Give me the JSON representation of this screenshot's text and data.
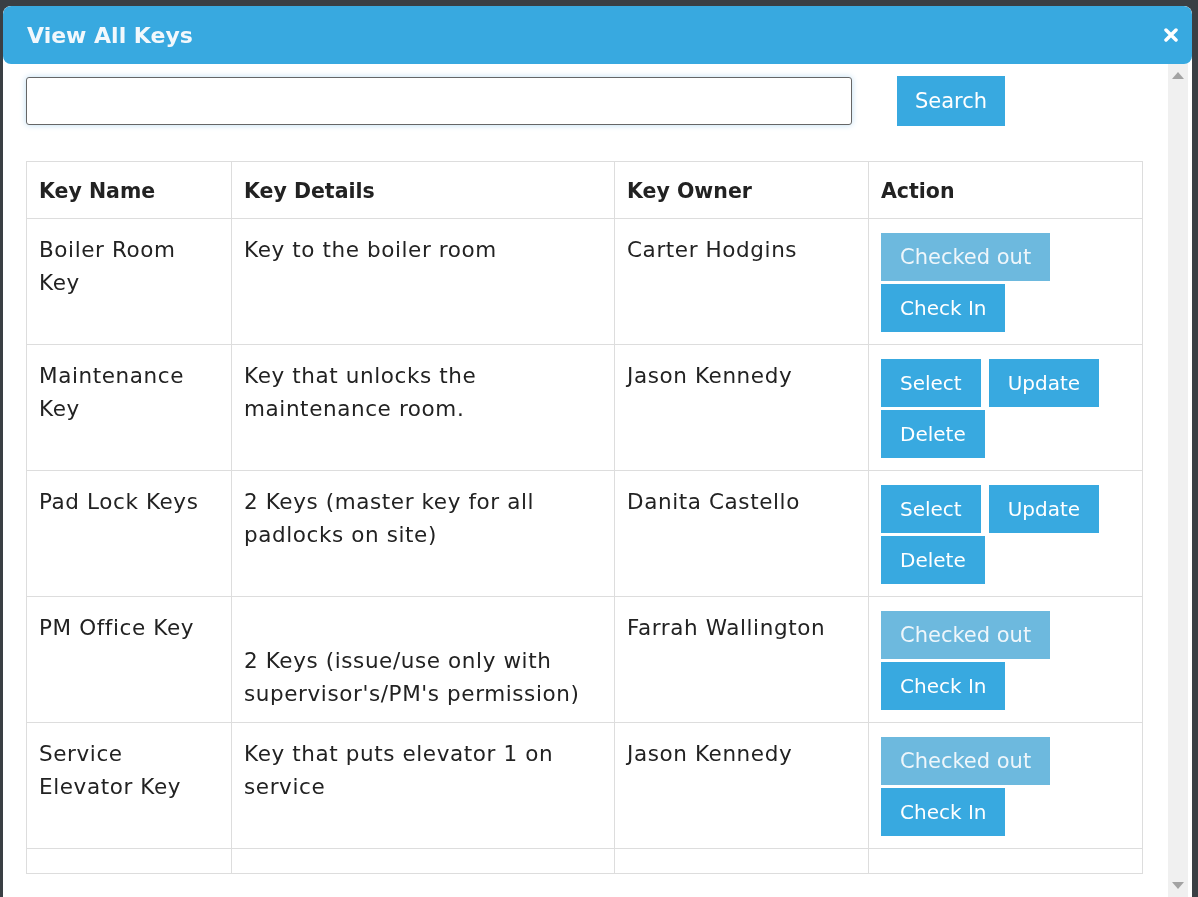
{
  "dialog": {
    "title": "View All Keys"
  },
  "search": {
    "button": "Search"
  },
  "table": {
    "columns": [
      "Key Name",
      "Key Details",
      "Key Owner",
      "Action"
    ],
    "rows": [
      {
        "name": "Boiler Room Key",
        "details": "Key to the boiler room",
        "leading_blank_line": false,
        "owner": "Carter Hodgins",
        "actions": [
          {
            "label": "Checked out",
            "disabled": true
          },
          {
            "label": "Check In",
            "disabled": false
          }
        ]
      },
      {
        "name": "Maintenance Key",
        "details": "Key that unlocks the maintenance room.",
        "leading_blank_line": false,
        "owner": "Jason Kennedy",
        "actions": [
          {
            "label": "Select",
            "disabled": false
          },
          {
            "label": "Update",
            "disabled": false
          },
          {
            "label": "Delete",
            "disabled": false
          }
        ]
      },
      {
        "name": "Pad Lock Keys",
        "details": "2 Keys (master key for all padlocks on site)",
        "leading_blank_line": false,
        "owner": "Danita Castello",
        "actions": [
          {
            "label": "Select",
            "disabled": false
          },
          {
            "label": "Update",
            "disabled": false
          },
          {
            "label": "Delete",
            "disabled": false
          }
        ]
      },
      {
        "name": "PM Office Key",
        "details": "2 Keys (issue/use only with supervisor's/PM's permission)",
        "leading_blank_line": true,
        "owner": "Farrah Wallington",
        "actions": [
          {
            "label": "Checked out",
            "disabled": true
          },
          {
            "label": "Check In",
            "disabled": false
          }
        ]
      },
      {
        "name": "Service Elevator Key",
        "details": "Key that puts elevator 1 on service",
        "leading_blank_line": false,
        "owner": "Jason Kennedy",
        "actions": [
          {
            "label": "Checked out",
            "disabled": true
          },
          {
            "label": "Check In",
            "disabled": false
          }
        ]
      }
    ]
  }
}
